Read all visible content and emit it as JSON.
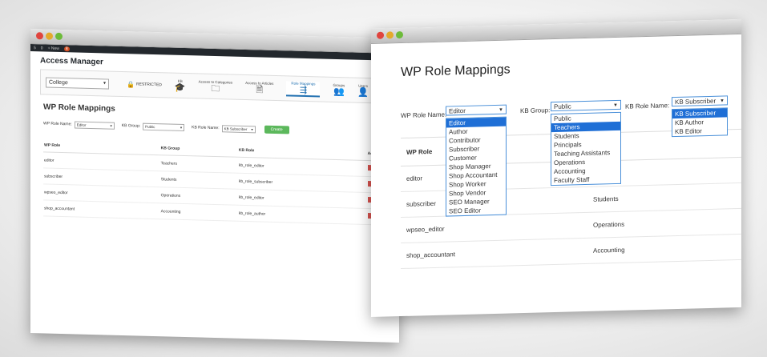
{
  "back_window": {
    "wp_admin_bar": {
      "count1": "5",
      "comments": "0",
      "new": "+ New",
      "badge": "8"
    },
    "title": "Access Manager",
    "site_select": "College",
    "restricted": "RESTRICTED",
    "nav": [
      {
        "label": "KB",
        "icon": "graduation-cap-icon",
        "glyph": "🎓"
      },
      {
        "label": "Access to Categories",
        "icon": "folder-icon",
        "glyph": "🗀"
      },
      {
        "label": "Access to Articles",
        "icon": "document-icon",
        "glyph": "🗎"
      },
      {
        "label": "Role Mappings",
        "icon": "signpost-icon",
        "glyph": "⇶"
      },
      {
        "label": "Groups",
        "icon": "users-icon",
        "glyph": "👥"
      },
      {
        "label": "Users",
        "icon": "user-card-icon",
        "glyph": "👤"
      }
    ],
    "heading": "WP Role Mappings",
    "form": {
      "wp_role_label": "WP Role Name:",
      "wp_role_value": "Editor",
      "kb_group_label": "KB Group:",
      "kb_group_value": "Public",
      "kb_role_label": "KB Role Name:",
      "kb_role_value": "KB Subscriber",
      "create_label": "Create"
    },
    "table": {
      "headers": [
        "WP Role",
        "KB Group",
        "KB Role",
        "Ac"
      ],
      "rows": [
        [
          "editor",
          "Teachers",
          "kb_role_editor"
        ],
        [
          "subscriber",
          "Students",
          "kb_role_subscriber"
        ],
        [
          "wpseo_editor",
          "Operations",
          "kb_role_editor"
        ],
        [
          "shop_accountant",
          "Accounting",
          "kb_role_author"
        ]
      ]
    }
  },
  "front_window": {
    "heading": "WP Role Mappings",
    "wp_role_label": "WP Role Name:",
    "wp_role_value": "Editor",
    "wp_role_options": [
      "Editor",
      "Author",
      "Contributor",
      "Subscriber",
      "Customer",
      "Shop Manager",
      "Shop Accountant",
      "Shop Worker",
      "Shop Vendor",
      "SEO Manager",
      "SEO Editor"
    ],
    "kb_group_label": "KB Group:",
    "kb_group_value": "Public",
    "kb_group_options": [
      "Public",
      "Teachers",
      "Students",
      "Principals",
      "Teaching Assistants",
      "Operations",
      "Accounting",
      "Faculty Staff"
    ],
    "kb_role_label": "KB Role Name:",
    "kb_role_value": "KB Subscriber",
    "kb_role_options": [
      "KB Subscriber",
      "KB Author",
      "KB Editor"
    ],
    "table": {
      "header": "WP Role",
      "rows": [
        [
          "editor",
          ""
        ],
        [
          "subscriber",
          "Students"
        ],
        [
          "wpseo_editor",
          "Operations"
        ],
        [
          "shop_accountant",
          "Accounting"
        ]
      ]
    }
  }
}
